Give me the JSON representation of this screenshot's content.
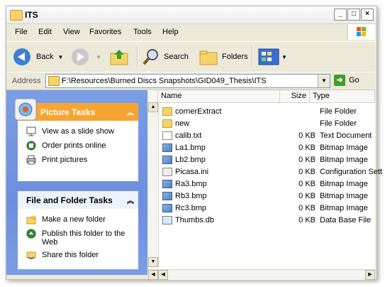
{
  "window": {
    "title": "ITS"
  },
  "menu": {
    "items": [
      {
        "label": "File"
      },
      {
        "label": "Edit"
      },
      {
        "label": "View"
      },
      {
        "label": "Favorites"
      },
      {
        "label": "Tools"
      },
      {
        "label": "Help"
      }
    ]
  },
  "toolbar": {
    "back_label": "Back",
    "search_label": "Search",
    "folders_label": "Folders"
  },
  "address": {
    "label": "Address",
    "value": "F:\\Resources\\Burned Discs Snapshots\\GID049_Thesis\\ITS",
    "go_label": "Go"
  },
  "picture_tasks": {
    "title": "Picture Tasks",
    "items": [
      {
        "label": "View as a slide show"
      },
      {
        "label": "Order prints online"
      },
      {
        "label": "Print pictures"
      }
    ]
  },
  "file_folder_tasks": {
    "title": "File and Folder Tasks",
    "items": [
      {
        "label": "Make a new folder"
      },
      {
        "label": "Publish this folder to the"
      },
      {
        "label": "Web"
      },
      {
        "label": "Share this folder"
      }
    ]
  },
  "columns": {
    "name": "Name",
    "size": "Size",
    "type": "Type"
  },
  "files": [
    {
      "name": "cornerExtract",
      "size": "",
      "type": "File Folder",
      "icon": "folder-icon"
    },
    {
      "name": "new",
      "size": "",
      "type": "File Folder",
      "icon": "folder-icon"
    },
    {
      "name": "calib.txt",
      "size": "0 KB",
      "type": "Text Document",
      "icon": "text-file-icon"
    },
    {
      "name": "La1.bmp",
      "size": "0 KB",
      "type": "Bitmap Image",
      "icon": "bitmap-icon"
    },
    {
      "name": "Lb2.bmp",
      "size": "0 KB",
      "type": "Bitmap Image",
      "icon": "bitmap-icon"
    },
    {
      "name": "Picasa.ini",
      "size": "0 KB",
      "type": "Configuration Sett",
      "icon": "config-file-icon"
    },
    {
      "name": "Ra3.bmp",
      "size": "0 KB",
      "type": "Bitmap Image",
      "icon": "bitmap-icon"
    },
    {
      "name": "Rb3.bmp",
      "size": "0 KB",
      "type": "Bitmap Image",
      "icon": "bitmap-icon"
    },
    {
      "name": "Rc3.bmp",
      "size": "0 KB",
      "type": "Bitmap Image",
      "icon": "bitmap-icon"
    },
    {
      "name": "Thumbs.db",
      "size": "0 KB",
      "type": "Data Base File",
      "icon": "database-file-icon"
    }
  ],
  "colors": {
    "task_pane": "#6d8fdc",
    "picture_tasks_header": "#f7a431",
    "file_tasks_header": "#eef2fb"
  }
}
